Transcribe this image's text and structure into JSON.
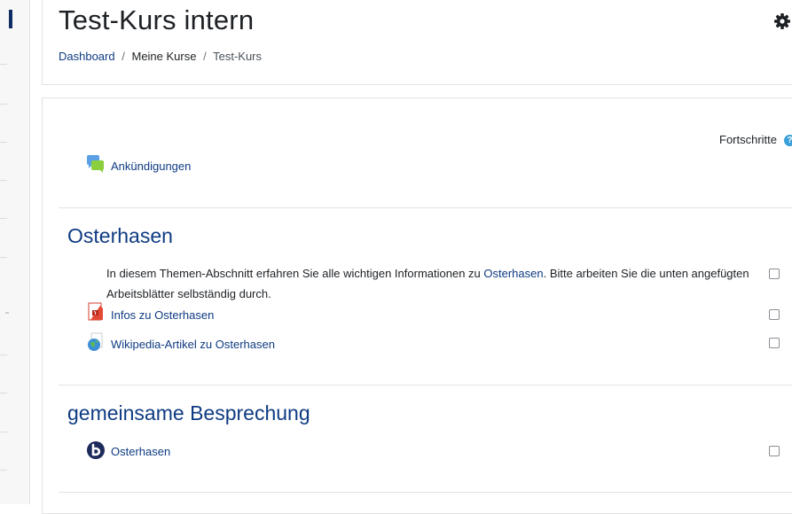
{
  "page": {
    "title": "Test-Kurs intern",
    "settings_icon": "gear-icon"
  },
  "breadcrumb": {
    "items": [
      "Dashboard",
      "Meine Kurse",
      "Test-Kurs"
    ],
    "separator": "/"
  },
  "course": {
    "progress_label": "Fortschritte",
    "progress_help_icon": "help-icon",
    "general": {
      "activities": [
        {
          "label": "Ankündigungen",
          "icon": "forum-icon"
        }
      ]
    },
    "sections": [
      {
        "title": "Osterhasen",
        "summary_before": "In diesem Themen-Abschnitt erfahren Sie alle wichtigen Informationen zu ",
        "summary_link": "Osterhasen",
        "summary_after": ". Bitte arbeiten Sie die unten angefügten Arbeitsblätter selbständig durch.",
        "activities": [
          {
            "label": "Infos zu Osterhasen",
            "icon": "pdf-file-icon"
          },
          {
            "label": "Wikipedia-Artikel zu Osterhasen",
            "icon": "url-globe-icon"
          }
        ]
      },
      {
        "title": "gemeinsame Besprechung",
        "activities": [
          {
            "label": "Osterhasen",
            "icon": "bigbluebutton-icon"
          }
        ]
      }
    ]
  },
  "colors": {
    "link": "#0f3b82",
    "text": "#1d2125",
    "accent_help": "#3aa0d8",
    "nav_marker": "#0f2c63"
  }
}
